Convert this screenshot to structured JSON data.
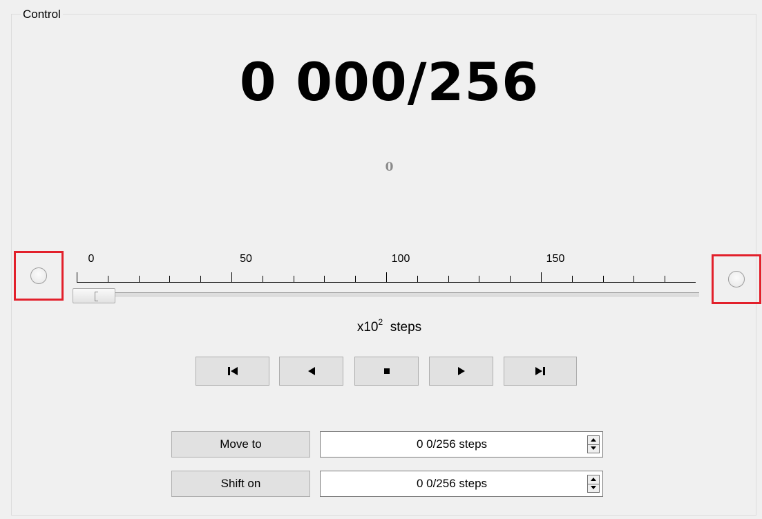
{
  "group": {
    "title": "Control"
  },
  "display": {
    "counter": "0 000/256",
    "sub_value": "0"
  },
  "ruler": {
    "labels": [
      "0",
      "50",
      "100",
      "150"
    ],
    "unit_base": "x10",
    "unit_exponent": "2",
    "unit_suffix": "steps"
  },
  "slider": {
    "value": 0,
    "min": 0,
    "max": 200
  },
  "nav": [
    {
      "name": "first-step-button",
      "icon": "skip-first-icon"
    },
    {
      "name": "previous-step-button",
      "icon": "play-back-icon"
    },
    {
      "name": "stop-button",
      "icon": "stop-icon"
    },
    {
      "name": "next-step-button",
      "icon": "play-forward-icon"
    },
    {
      "name": "last-step-button",
      "icon": "skip-last-icon"
    }
  ],
  "move_to": {
    "label": "Move to",
    "value": "0 0/256 steps"
  },
  "shift_on": {
    "label": "Shift on",
    "value": "0 0/256 steps"
  },
  "colors": {
    "highlight": "#e2202b",
    "background": "#f0f0f0",
    "button": "#e1e1e1"
  }
}
